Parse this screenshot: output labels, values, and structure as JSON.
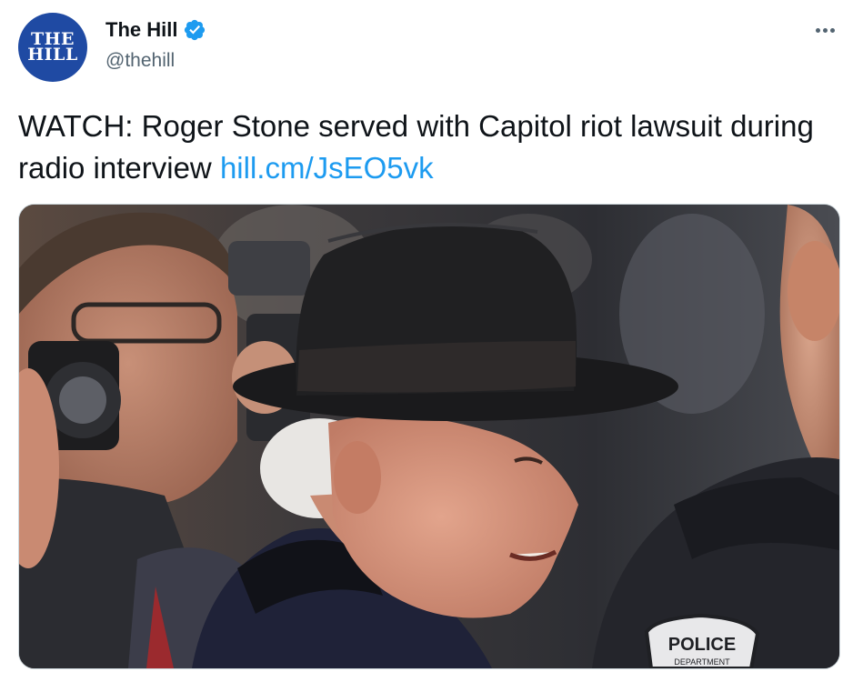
{
  "account": {
    "avatar_text_line1": "THE",
    "avatar_text_line2": "HILL",
    "display_name": "The Hill",
    "handle": "@thehill",
    "verified": true
  },
  "tweet": {
    "text": "WATCH: Roger Stone served with Capitol riot lawsuit during radio interview ",
    "link_text": "hill.cm/JsEO5vk"
  },
  "media": {
    "badge_text": "POLICE",
    "badge_subtext": "DEPARTMENT"
  },
  "icons": {
    "verified": "verified-badge-icon",
    "more": "more-options-icon"
  },
  "colors": {
    "link": "#1d9bf0",
    "avatar_bg": "#1f4aa3",
    "secondary_text": "#536471",
    "verified": "#1d9bf0"
  }
}
